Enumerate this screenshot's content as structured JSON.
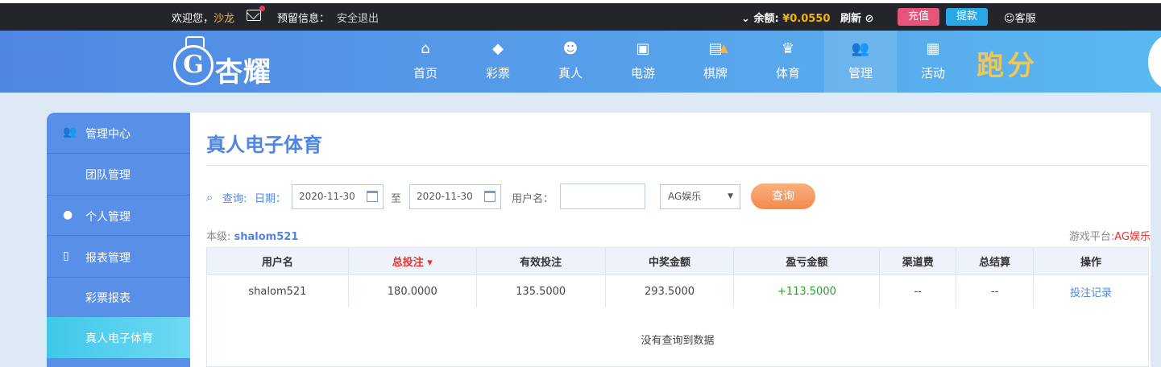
{
  "topbar": {
    "welcome": "欢迎您，",
    "username": "沙龙",
    "reserve_label": "预留信息：",
    "logout": "安全退出",
    "balance_label": "余额:",
    "balance": "¥0.0550",
    "refresh": "刷新",
    "recharge": "充值",
    "withdraw": "提款",
    "service": "客服"
  },
  "logo": {
    "mark": "G",
    "name": "杏耀"
  },
  "nav": [
    {
      "label": "首页",
      "icon": "home-icon"
    },
    {
      "label": "彩票",
      "icon": "lottery-icon"
    },
    {
      "label": "真人",
      "icon": "live-dealer-icon"
    },
    {
      "label": "电游",
      "icon": "slot-icon"
    },
    {
      "label": "棋牌",
      "icon": "cards-icon"
    },
    {
      "label": "体育",
      "icon": "trophy-icon"
    },
    {
      "label": "管理",
      "icon": "users-icon"
    },
    {
      "label": "活动",
      "icon": "gift-icon"
    }
  ],
  "promo": "跑分",
  "sidebar": {
    "items": [
      {
        "label": "管理中心"
      },
      {
        "label": "团队管理"
      },
      {
        "label": "个人管理"
      },
      {
        "label": "报表管理"
      },
      {
        "label": "彩票报表"
      },
      {
        "label": "真人电子体育"
      }
    ]
  },
  "main": {
    "title": "真人电子体育",
    "query": {
      "search_label": "查询:",
      "date_label": "日期：",
      "date_from": "2020-11-30",
      "to_label": "至",
      "date_to": "2020-11-30",
      "user_label": "用户名：",
      "user_value": "",
      "platform_selected": "AG娱乐",
      "submit": "查询"
    },
    "level_label": "本级:",
    "level_user": "shalom521",
    "platform_label": "游戏平台:",
    "platform_value": "AG娱乐",
    "table": {
      "headers": [
        "用户名",
        "总投注",
        "有效投注",
        "中奖金额",
        "盈亏金额",
        "渠道费",
        "总结算",
        "操作"
      ],
      "rows": [
        [
          "shalom521",
          "180.0000",
          "135.5000",
          "293.5000",
          "+113.5000",
          "--",
          "--",
          "投注记录"
        ]
      ]
    },
    "empty_text": "没有查询到数据"
  }
}
